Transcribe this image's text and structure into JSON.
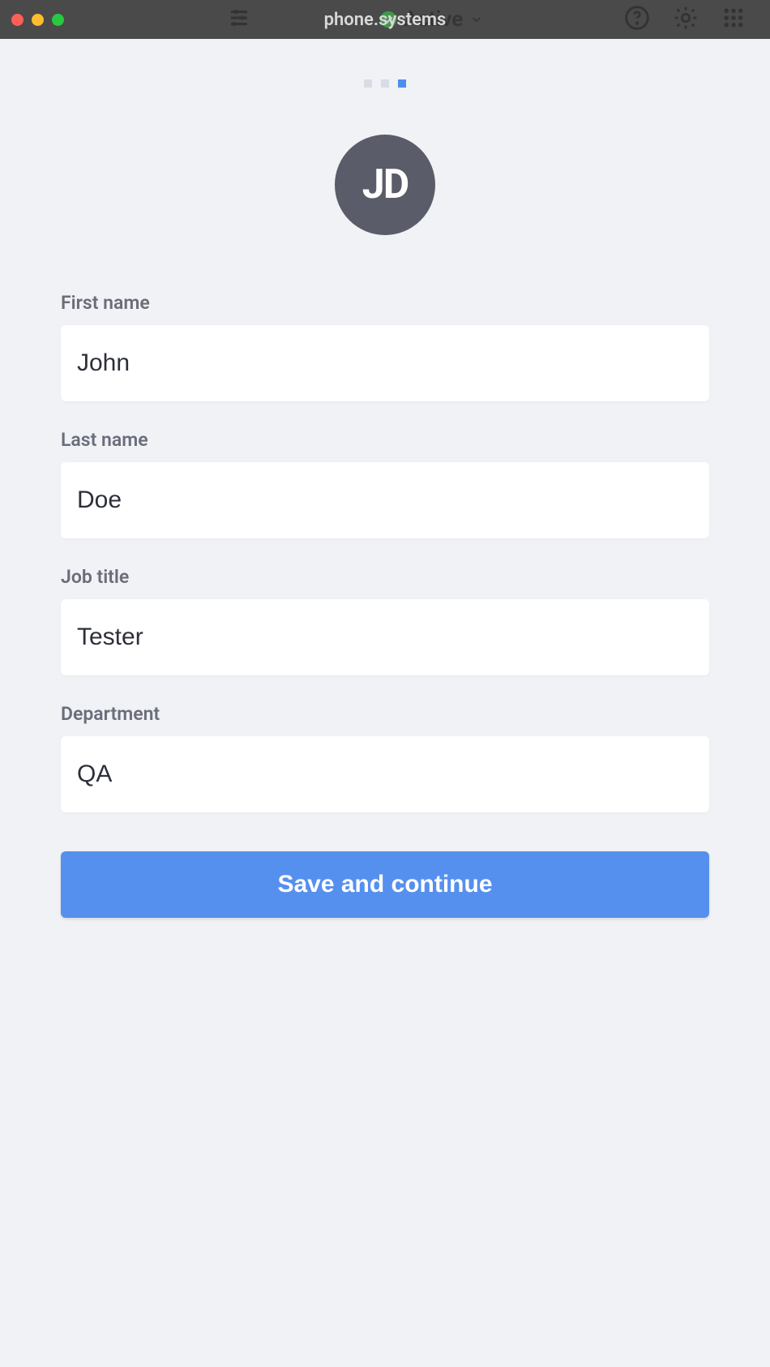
{
  "titlebar": {
    "title": "phone.systems",
    "background_status": "Active"
  },
  "pagination": {
    "total": 3,
    "active_index": 2
  },
  "avatar": {
    "initials": "JD"
  },
  "form": {
    "first_name": {
      "label": "First name",
      "value": "John"
    },
    "last_name": {
      "label": "Last name",
      "value": "Doe"
    },
    "job_title": {
      "label": "Job title",
      "value": "Tester"
    },
    "department": {
      "label": "Department",
      "value": "QA"
    }
  },
  "actions": {
    "save_label": "Save and continue"
  }
}
